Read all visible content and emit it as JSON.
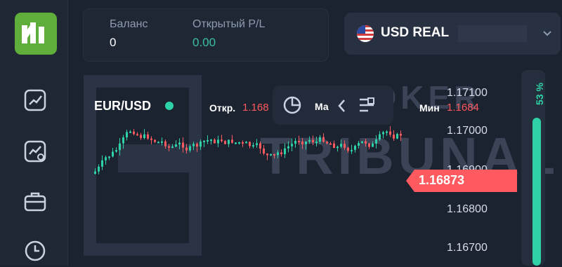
{
  "sidebar": {
    "logo": "broker-logo",
    "items": [
      {
        "icon": "chart-icon"
      },
      {
        "icon": "chart-settings-icon"
      },
      {
        "icon": "briefcase-icon"
      },
      {
        "icon": "clock-icon"
      }
    ]
  },
  "header": {
    "balance_label": "Баланс",
    "balance_value": "0",
    "pl_label": "Открытый P/L",
    "pl_value": "0.00",
    "account_label": "USD REAL",
    "account_flag": "us-flag-icon"
  },
  "chart": {
    "pair": "EUR/USD",
    "open_label": "Откр.",
    "open_value": "1.168",
    "max_label": "Ма",
    "min_label": "Мин",
    "min_value": "1.1684",
    "current_price": "1.16873",
    "price_ticks": [
      "1.17100",
      "1.17000",
      "1.16900",
      "1.16800",
      "1.16700"
    ],
    "sentiment_percent": "53 %",
    "watermark_line1": "BROKER",
    "watermark_line2": "TRIBUNAL"
  },
  "colors": {
    "up": "#2fd1a6",
    "down": "#ff5a5f",
    "background": "#1b2230",
    "logo": "#5fae3b"
  }
}
